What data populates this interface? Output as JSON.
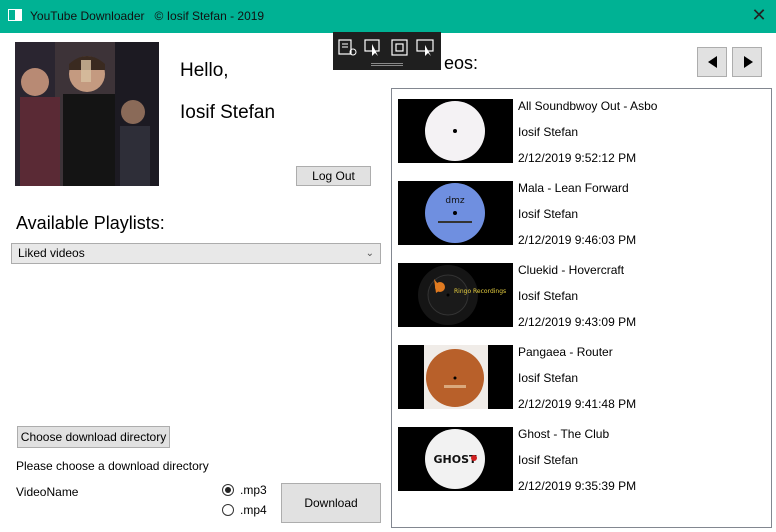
{
  "window": {
    "title": "YouTube Downloader   © Iosif Stefan - 2019",
    "close_label": "✕"
  },
  "profile": {
    "greeting": "Hello,",
    "username": "Iosif Stefan",
    "logout_label": "Log Out"
  },
  "playlists": {
    "label": "Available Playlists:",
    "selected": "Liked videos"
  },
  "download": {
    "choose_dir_label": "Choose download directory",
    "dir_status": "Please choose a download directory",
    "video_name_label": "VideoName",
    "formats": [
      {
        "label": ".mp3",
        "selected": true
      },
      {
        "label": ".mp4",
        "selected": false
      }
    ],
    "download_label": "Download"
  },
  "videos": {
    "label_visible": "eos:",
    "items": [
      {
        "title": "All Soundbwoy Out - Asbo",
        "channel": "Iosif Stefan",
        "date": "2/12/2019 9:52:12 PM",
        "thumb": "white-vinyl-label"
      },
      {
        "title": "Mala - Lean Forward",
        "channel": "Iosif Stefan",
        "date": "2/12/2019 9:46:03 PM",
        "thumb": "blue-dmz-vinyl-label",
        "label_text": "dmz"
      },
      {
        "title": "Cluekid - Hovercraft",
        "channel": "Iosif Stefan",
        "date": "2/12/2019 9:43:09 PM",
        "thumb": "black-ringo-vinyl-label",
        "label_text": "Ringo Recordings"
      },
      {
        "title": "Pangaea - Router",
        "channel": "Iosif Stefan",
        "date": "2/12/2019 9:41:48 PM",
        "thumb": "brown-vinyl-label"
      },
      {
        "title": "Ghost - The Club",
        "channel": "Iosif Stefan",
        "date": "2/12/2019 9:35:39 PM",
        "thumb": "ghost-vinyl-label",
        "label_text": "GHOST"
      }
    ]
  },
  "colors": {
    "titlebar": "#00b294",
    "button_bg": "#e1e1e1",
    "button_border": "#adadad"
  }
}
